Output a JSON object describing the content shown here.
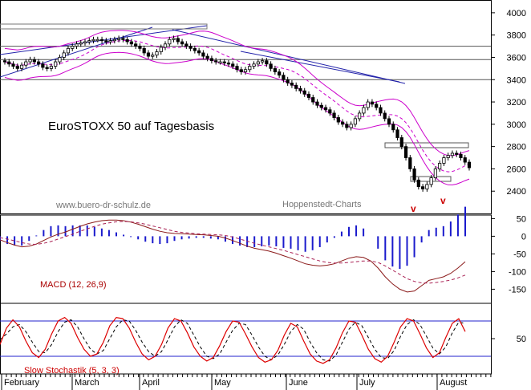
{
  "chart_data": [
    {
      "type": "candlestick",
      "title": "EuroSTOXX 50 auf Tagesbasis",
      "watermarks": [
        "www.buero-dr-schulz.de",
        "Hoppenstedt-Charts"
      ],
      "markers": [
        "v",
        "v"
      ],
      "ylim": [
        2200,
        4100
      ],
      "yticks": [
        4000,
        3800,
        3600,
        3400,
        3200,
        3000,
        2800,
        2600,
        2400
      ],
      "horizontal_lines": [
        3700,
        3580,
        3400
      ],
      "x_labels": [
        "February",
        "March",
        "April",
        "May",
        "June",
        "July",
        "August"
      ],
      "close": [
        3560,
        3540,
        3520,
        3500,
        3530,
        3560,
        3580,
        3560,
        3540,
        3510,
        3500,
        3520,
        3560,
        3600,
        3640,
        3680,
        3700,
        3720,
        3730,
        3740,
        3750,
        3760,
        3760,
        3750,
        3740,
        3750,
        3760,
        3770,
        3760,
        3740,
        3720,
        3700,
        3680,
        3640,
        3610,
        3620,
        3650,
        3690,
        3720,
        3760,
        3770,
        3740,
        3720,
        3700,
        3680,
        3660,
        3640,
        3610,
        3590,
        3570,
        3560,
        3560,
        3550,
        3540,
        3520,
        3490,
        3470,
        3490,
        3520,
        3540,
        3560,
        3570,
        3540,
        3500,
        3470,
        3440,
        3400,
        3370,
        3350,
        3320,
        3300,
        3270,
        3240,
        3200,
        3170,
        3150,
        3130,
        3100,
        3060,
        3020,
        3000,
        2970,
        3000,
        3050,
        3100,
        3150,
        3200,
        3180,
        3150,
        3100,
        3050,
        3000,
        2950,
        2880,
        2800,
        2700,
        2600,
        2500,
        2440,
        2420,
        2460,
        2520,
        2600,
        2650,
        2700,
        2720,
        2740,
        2730,
        2700,
        2660,
        2610
      ]
    },
    {
      "type": "line",
      "title": "MACD (12, 26,9)",
      "ylim": [
        -190,
        60
      ],
      "yticks": [
        50,
        0,
        -50,
        -100,
        -150
      ],
      "series": [
        {
          "values": [
            -10,
            -18,
            -25,
            -30,
            -28,
            -22,
            -12,
            -2,
            6,
            12,
            20,
            28,
            35,
            40,
            44,
            46,
            46,
            44,
            40,
            34,
            27,
            20,
            14,
            10,
            8,
            7,
            6,
            5,
            4,
            2,
            0,
            -5,
            -12,
            -20,
            -28,
            -34,
            -38,
            -42,
            -48,
            -55,
            -62,
            -70,
            -78,
            -82,
            -84,
            -82,
            -78,
            -70,
            -62,
            -58,
            -60,
            -70,
            -90,
            -115,
            -135,
            -150,
            -158,
            -155,
            -140,
            -125,
            -120,
            -115,
            -105,
            -90,
            -72
          ]
        },
        {
          "values": [
            -4,
            -8,
            -13,
            -18,
            -22,
            -23,
            -20,
            -15,
            -8,
            -1,
            6,
            14,
            21,
            28,
            34,
            38,
            41,
            42,
            41,
            38,
            34,
            29,
            24,
            19,
            14,
            11,
            9,
            7,
            6,
            5,
            4,
            2,
            -2,
            -8,
            -14,
            -20,
            -25,
            -30,
            -35,
            -40,
            -46,
            -52,
            -58,
            -64,
            -70,
            -74,
            -76,
            -76,
            -74,
            -72,
            -70,
            -70,
            -74,
            -84,
            -96,
            -108,
            -120,
            -128,
            -132,
            -133,
            -131,
            -128,
            -124,
            -118,
            -110
          ]
        }
      ]
    },
    {
      "type": "line",
      "title": "Slow Stochastik (5, 3, 3)",
      "ylim": [
        0,
        100
      ],
      "yticks": [
        50
      ],
      "series": [
        {
          "values": [
            40,
            68,
            82,
            70,
            46,
            26,
            18,
            32,
            58,
            80,
            86,
            76,
            52,
            32,
            20,
            24,
            44,
            72,
            86,
            84,
            68,
            44,
            24,
            14,
            20,
            40,
            68,
            84,
            80,
            60,
            36,
            20,
            12,
            18,
            38,
            62,
            80,
            78,
            58,
            36,
            18,
            10,
            14,
            30,
            56,
            76,
            70,
            46,
            24,
            12,
            8,
            14,
            34,
            60,
            80,
            78,
            56,
            32,
            16,
            10,
            20,
            44,
            70,
            84,
            80,
            58,
            34,
            18,
            26,
            52,
            76,
            84,
            62
          ]
        },
        {
          "values": [
            48,
            58,
            70,
            74,
            62,
            44,
            28,
            26,
            40,
            62,
            78,
            82,
            70,
            50,
            32,
            24,
            30,
            50,
            70,
            82,
            80,
            64,
            44,
            28,
            20,
            28,
            48,
            70,
            82,
            76,
            56,
            36,
            20,
            16,
            24,
            44,
            64,
            76,
            74,
            56,
            36,
            20,
            14,
            22,
            40,
            62,
            74,
            66,
            44,
            26,
            14,
            12,
            22,
            44,
            66,
            78,
            72,
            52,
            32,
            18,
            16,
            30,
            54,
            74,
            82,
            74,
            54,
            34,
            24,
            36,
            60,
            78,
            76
          ]
        }
      ]
    }
  ]
}
